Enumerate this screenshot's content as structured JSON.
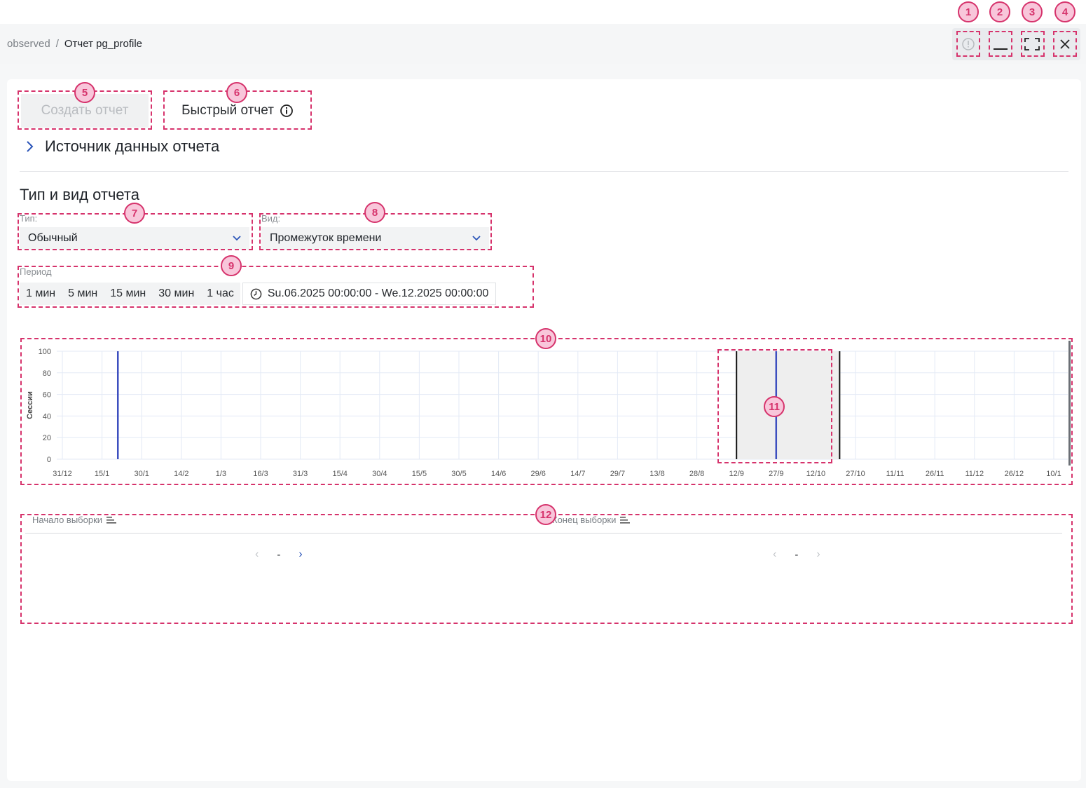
{
  "breadcrumb": {
    "parent": "observed",
    "separator": "/",
    "current": "Отчет pg_profile"
  },
  "window_controls": [
    "info-icon",
    "minimize-icon",
    "fullscreen-icon",
    "close-icon"
  ],
  "markers": [
    "1",
    "2",
    "3",
    "4",
    "5",
    "6",
    "7",
    "8",
    "9",
    "10",
    "11",
    "12"
  ],
  "actions": {
    "create_label": "Создать отчет",
    "quick_label": "Быстрый отчет"
  },
  "source": {
    "label": "Источник данных отчета"
  },
  "section": {
    "title": "Тип и вид отчета"
  },
  "type_field": {
    "label": "Тип:",
    "value": "Обычный"
  },
  "view_field": {
    "label": "Вид:",
    "value": "Промежуток времени"
  },
  "period": {
    "label": "Период",
    "presets": [
      "1 мин",
      "5 мин",
      "15 мин",
      "30 мин",
      "1 час"
    ],
    "range": "Su.06.2025 00:00:00 - We.12.2025 00:00:00"
  },
  "table": {
    "col_start": "Начало выборки",
    "col_end": "Конец выборки",
    "pager_left": "-",
    "pager_right": "-"
  },
  "colors": {
    "accent": "#d6336c",
    "series": "#3d4fbf",
    "selection": "#eeeeee"
  },
  "chart_data": {
    "type": "line",
    "ylabel": "Сессии",
    "ylim": [
      0,
      100
    ],
    "yticks": [
      0,
      20,
      40,
      60,
      80,
      100
    ],
    "x_ticks": [
      "31/12",
      "15/1",
      "30/1",
      "14/2",
      "1/3",
      "16/3",
      "31/3",
      "15/4",
      "30/4",
      "15/5",
      "30/5",
      "14/6",
      "29/6",
      "14/7",
      "29/7",
      "13/8",
      "28/8",
      "12/9",
      "27/9",
      "12/10",
      "27/10",
      "11/11",
      "26/11",
      "11/12",
      "26/12",
      "10/1"
    ],
    "spikes": [
      {
        "x": "22/1",
        "value": 100
      },
      {
        "x": "27/9",
        "value": 100
      }
    ],
    "selection": {
      "from": "12/9",
      "to": "21/10"
    },
    "grid": true
  }
}
